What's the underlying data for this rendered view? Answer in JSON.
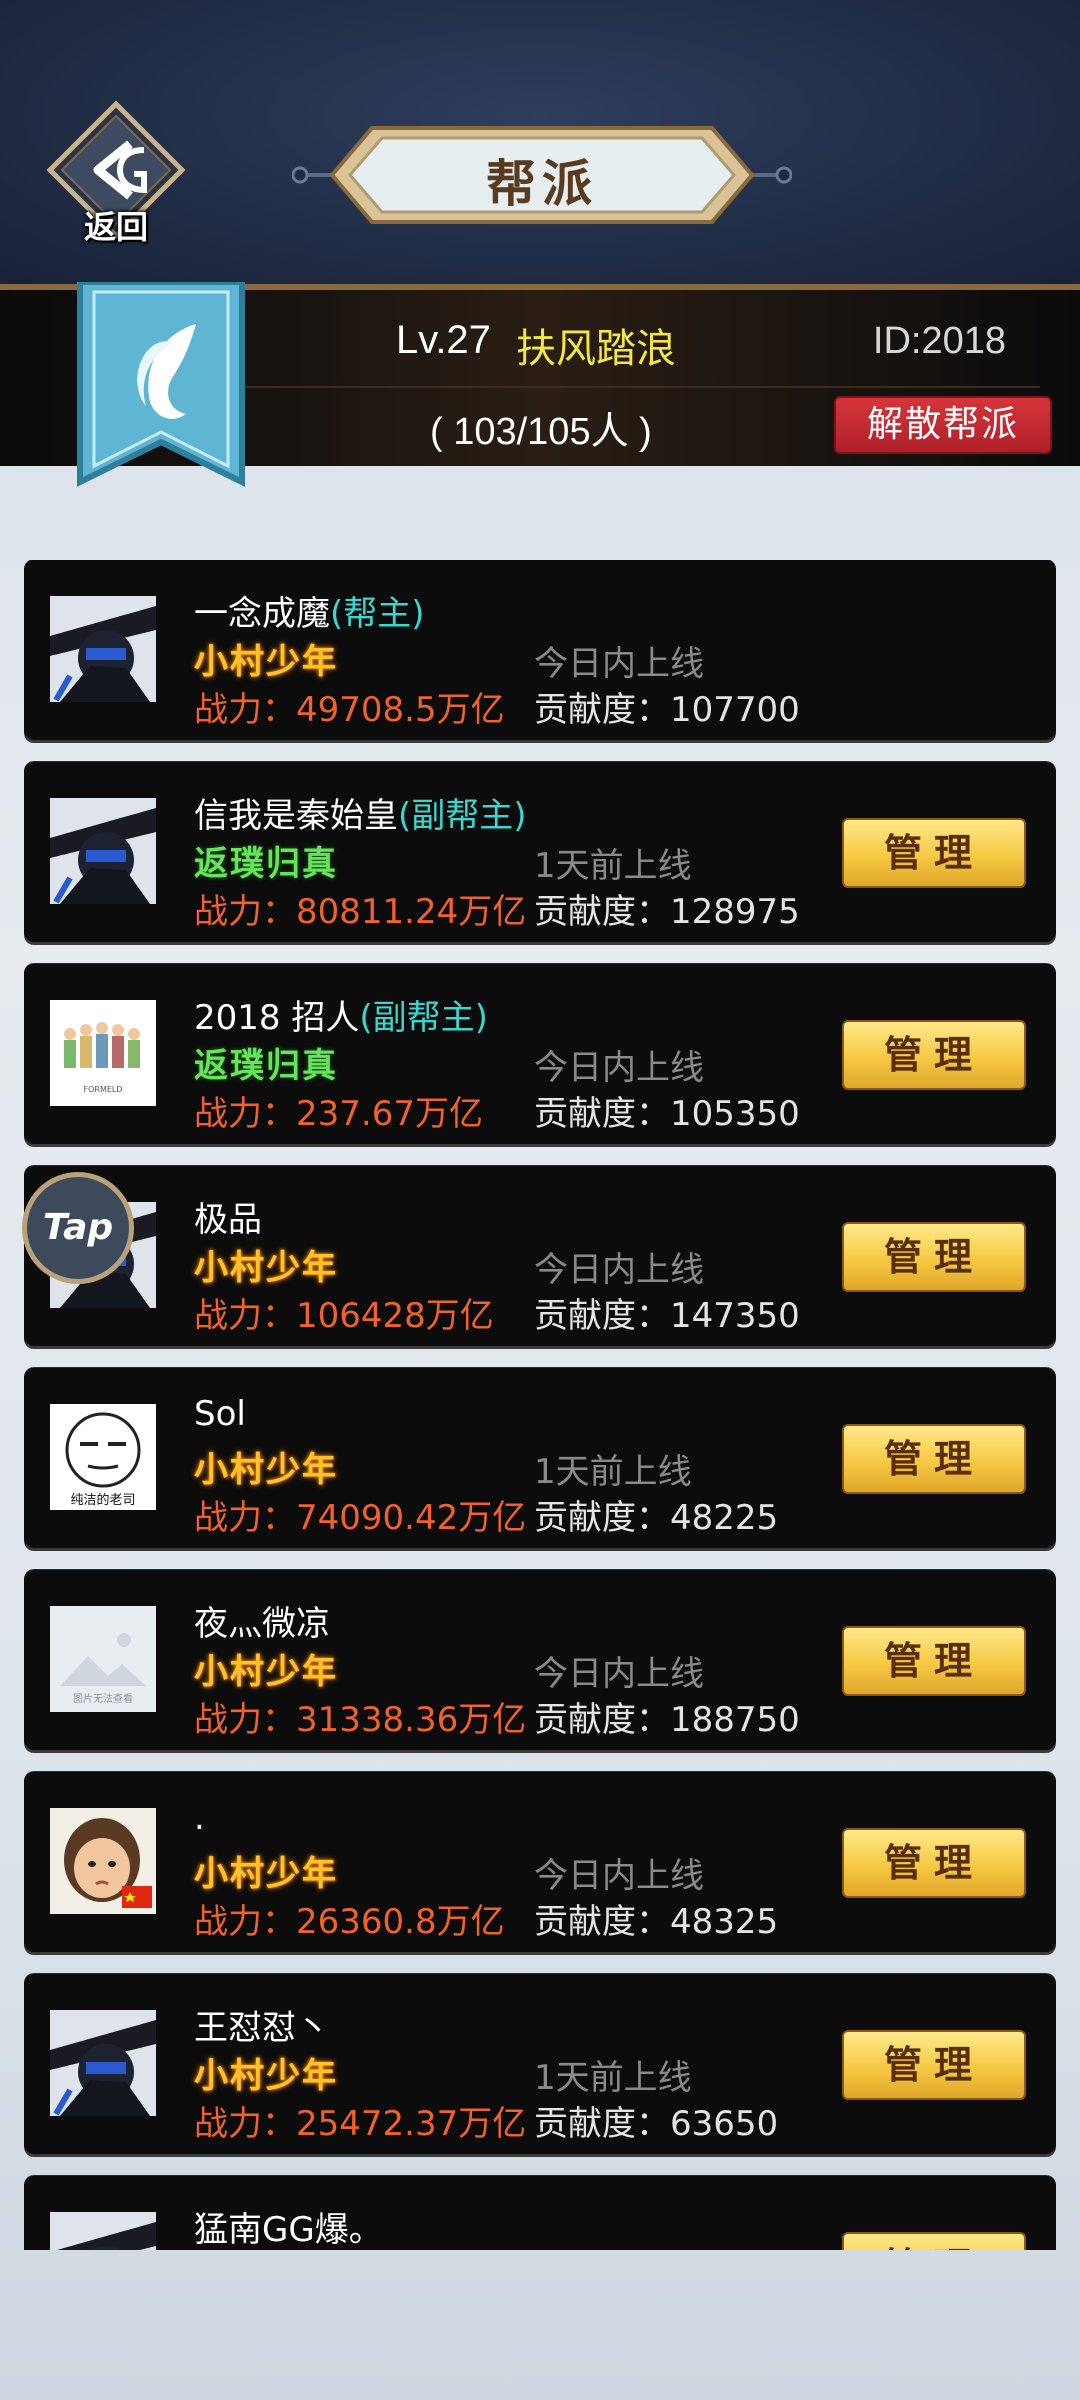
{
  "header": {
    "back_label": "返回",
    "title": "帮派"
  },
  "guild": {
    "level": "Lv.27",
    "name": "扶风踏浪",
    "id": "ID:2018",
    "members": "( 103/105人 )",
    "disband_label": "解散帮派"
  },
  "manage_label": "管理",
  "members": [
    {
      "name": "一念成魔",
      "role": "(帮主)",
      "rank": "小村少年",
      "rank_style": "gold",
      "power": "战力：49708.5万亿",
      "online": "今日内上线",
      "contrib": "贡献度：107700",
      "manage": false
    },
    {
      "name": "信我是秦始皇",
      "role": "(副帮主)",
      "rank": "返璞归真",
      "rank_style": "green",
      "power": "战力：80811.24万亿",
      "online": "1天前上线",
      "contrib": "贡献度：128975",
      "manage": true
    },
    {
      "name": "2018 招人",
      "role": "(副帮主)",
      "rank": "返璞归真",
      "rank_style": "green",
      "power": "战力：237.67万亿",
      "online": "今日内上线",
      "contrib": "贡献度：105350",
      "manage": true
    },
    {
      "name": "极品",
      "role": "",
      "rank": "小村少年",
      "rank_style": "gold",
      "power": "战力：106428万亿",
      "online": "今日内上线",
      "contrib": "贡献度：147350",
      "manage": true
    },
    {
      "name": "Sol",
      "role": "",
      "rank": "小村少年",
      "rank_style": "gold",
      "power": "战力：74090.42万亿",
      "online": "1天前上线",
      "contrib": "贡献度：48225",
      "manage": true
    },
    {
      "name": "夜灬微凉",
      "role": "",
      "rank": "小村少年",
      "rank_style": "gold",
      "power": "战力：31338.36万亿",
      "online": "今日内上线",
      "contrib": "贡献度：188750",
      "manage": true
    },
    {
      "name": ".",
      "role": "",
      "rank": "小村少年",
      "rank_style": "gold",
      "power": "战力：26360.8万亿",
      "online": "今日内上线",
      "contrib": "贡献度：48325",
      "manage": true
    },
    {
      "name": "王怼怼丶",
      "role": "",
      "rank": "小村少年",
      "rank_style": "gold",
      "power": "战力：25472.37万亿",
      "online": "1天前上线",
      "contrib": "贡献度：63650",
      "manage": true
    },
    {
      "name": "猛南GG爆。",
      "role": "",
      "rank": "",
      "rank_style": "gold",
      "power": "",
      "online": "",
      "contrib": "",
      "manage": true
    }
  ],
  "avatar_texts": {
    "avatar_3": "FORMELD",
    "avatar_5": "纯洁的老司",
    "avatar_6": "图片无法查看"
  },
  "overlay": {
    "tap_label": "Tap"
  }
}
